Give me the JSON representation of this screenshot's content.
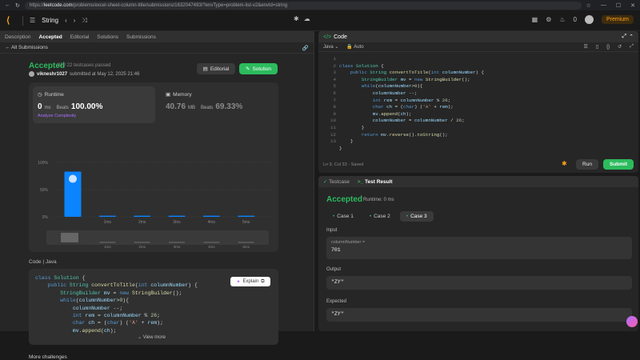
{
  "browser": {
    "url_prefix": "https://",
    "url_host": "leetcode.com",
    "url_path": "/problems/excel-sheet-column-title/submissions/1632047493/?envType=problem-list-v2&envId=string"
  },
  "topbar": {
    "topic": "String",
    "notif_count": "0",
    "premium": "Premium"
  },
  "left_tabs": [
    {
      "label": "Description"
    },
    {
      "label": "Accepted"
    },
    {
      "label": "Editorial"
    },
    {
      "label": "Solutions"
    },
    {
      "label": "Submissions"
    }
  ],
  "all_submissions": "All Submissions",
  "result": {
    "status": "Accepted",
    "testcases": "22 / 22 testcases passed",
    "user": "vikneshr1027",
    "submitted": "submitted at May 12, 2025 21:46",
    "editorial_btn": "Editorial",
    "solution_btn": "Solution"
  },
  "runtime": {
    "label": "Runtime",
    "value": "0",
    "unit": "ms",
    "beats_label": "Beats",
    "beats": "100.00%",
    "analyze": "Analyze Complexity"
  },
  "memory": {
    "label": "Memory",
    "value": "40.76",
    "unit": "MB",
    "beats_label": "Beats",
    "beats": "69.33%"
  },
  "chart_data": {
    "type": "bar",
    "categories": [
      "0ms",
      "1ms",
      "2ms",
      "3ms",
      "4ms",
      "5ms"
    ],
    "values": [
      83,
      2,
      2,
      2,
      2,
      2
    ],
    "ylim": [
      0,
      100
    ],
    "yticks": [
      "100%",
      "50%",
      "0%"
    ],
    "xticks": [
      "1ms",
      "2ms",
      "3ms",
      "4ms",
      "5ms"
    ],
    "highlight_index": 0,
    "color": "#0a84ff"
  },
  "code_section": {
    "label": "Code",
    "lang": "Java",
    "explain": "Explain",
    "view_more": "View more",
    "more_challenges": "More challenges",
    "lines": [
      "class Solution {",
      "    public String convertToTitle(int columnNumber) {",
      "        StringBuilder mv = new StringBuilder();",
      "        while(columnNumber>0){",
      "            columnNumber --;",
      "            int rem = columnNumber % 26;",
      "            char ch = (char) ('A' + rem);",
      "            mv.append(ch);"
    ]
  },
  "editor": {
    "title": "Code",
    "lang": "Java",
    "mode": "Auto",
    "status": "Ln 9, Col 33",
    "saved": "Saved",
    "run": "Run",
    "submit": "Submit",
    "line_numbers": [
      "1",
      "2",
      "3",
      "4",
      "5",
      "6",
      "7",
      "8",
      "9",
      "10",
      "11",
      "12",
      "13"
    ],
    "lines": [
      "class Solution {",
      "    public String convertToTitle(int columnNumber) {",
      "        StringBuilder mv = new StringBuilder();",
      "        while(columnNumber>0){",
      "            columnNumber --;",
      "            int rem = columnNumber % 26;",
      "            char ch = (char) ('A' + rem);",
      "            mv.append(ch);",
      "            columnNumber = columnNumber / 26;",
      "        }",
      "        return mv.reverse().toString();",
      "    }",
      "}"
    ]
  },
  "test": {
    "tab_testcase": "Testcase",
    "tab_result": "Test Result",
    "status": "Accepted",
    "runtime": "Runtime: 0 ms",
    "cases": [
      "Case 1",
      "Case 2",
      "Case 3"
    ],
    "input_label": "Input",
    "input_var": "columnNumber =",
    "input_value": "701",
    "output_label": "Output",
    "output_value": "\"ZY\"",
    "expected_label": "Expected",
    "expected_value": "\"ZY\""
  }
}
